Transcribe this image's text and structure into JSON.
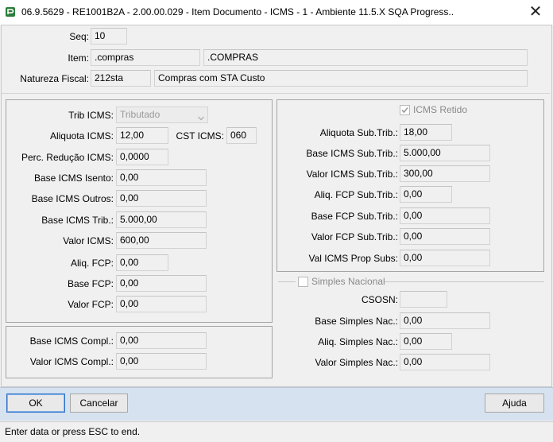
{
  "window": {
    "title": "06.9.5629 - RE1001B2A - 2.00.00.029 - Item Documento - ICMS - 1 - Ambiente 11.5.X SQA Progress..",
    "close_glyph": "✕",
    "app_icon": "progress-app-icon"
  },
  "header": {
    "seq_label": "Seq:",
    "seq_value": "10",
    "item_label": "Item:",
    "item_code": ".compras",
    "item_desc": ".COMPRAS",
    "natureza_label": "Natureza Fiscal:",
    "natureza_code": "212sta",
    "natureza_desc": "Compras com STA Custo"
  },
  "icms": {
    "trib_label": "Trib ICMS:",
    "trib_value": "Tributado",
    "aliquota_label": "Aliquota ICMS:",
    "aliquota_value": "12,00",
    "cst_label": "CST ICMS:",
    "cst_value": "060",
    "perc_reducao_label": "Perc. Redução ICMS:",
    "perc_reducao_value": "0,0000",
    "base_isento_label": "Base ICMS Isento:",
    "base_isento_value": "0,00",
    "base_outros_label": "Base ICMS Outros:",
    "base_outros_value": "0,00",
    "base_trib_label": "Base ICMS Trib.:",
    "base_trib_value": "5.000,00",
    "valor_icms_label": "Valor ICMS:",
    "valor_icms_value": "600,00",
    "aliq_fcp_label": "Aliq. FCP:",
    "aliq_fcp_value": "0,00",
    "base_fcp_label": "Base FCP:",
    "base_fcp_value": "0,00",
    "valor_fcp_label": "Valor FCP:",
    "valor_fcp_value": "0,00"
  },
  "compl": {
    "base_label": "Base ICMS Compl.:",
    "base_value": "0,00",
    "valor_label": "Valor ICMS Compl.:",
    "valor_value": "0,00"
  },
  "st": {
    "retido_label": "ICMS Retido",
    "retido_checked": true,
    "aliquota_label": "Aliquota Sub.Trib.:",
    "aliquota_value": "18,00",
    "base_label": "Base ICMS Sub.Trib.:",
    "base_value": "5.000,00",
    "valor_label": "Valor ICMS Sub.Trib.:",
    "valor_value": "300,00",
    "aliq_fcp_label": "Aliq. FCP Sub.Trib.:",
    "aliq_fcp_value": "0,00",
    "base_fcp_label": "Base FCP Sub.Trib.:",
    "base_fcp_value": "0,00",
    "valor_fcp_label": "Valor FCP Sub.Trib.:",
    "valor_fcp_value": "0,00",
    "prop_label": "Val ICMS Prop Subs:",
    "prop_value": "0,00"
  },
  "simples": {
    "group_label": "Simples Nacional",
    "checked": false,
    "csosn_label": "CSOSN:",
    "csosn_value": "",
    "base_label": "Base Simples Nac.:",
    "base_value": "0,00",
    "aliq_label": "Aliq. Simples Nac.:",
    "aliq_value": "0,00",
    "valor_label": "Valor Simples Nac.:",
    "valor_value": "0,00"
  },
  "buttons": {
    "ok": "OK",
    "cancel": "Cancelar",
    "help": "Ajuda"
  },
  "status": {
    "text": "Enter data or press ESC to end."
  },
  "colors": {
    "bottom_bar": "#d6e2ef",
    "ok_border": "#2f6fc5"
  }
}
